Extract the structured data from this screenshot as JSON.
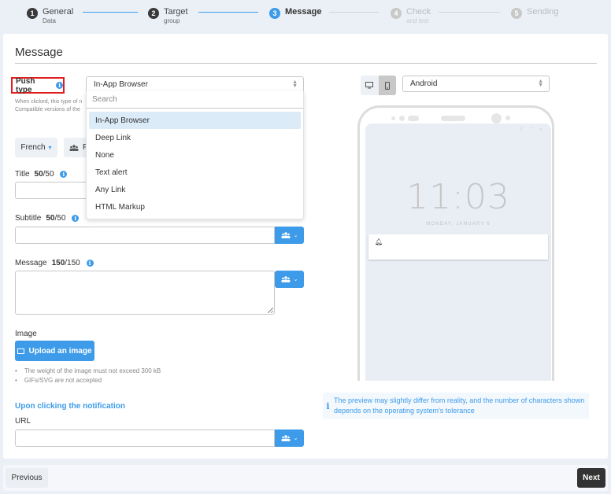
{
  "stepper": {
    "steps": [
      {
        "num": "1",
        "title": "General",
        "sub": "Data",
        "state": "done"
      },
      {
        "num": "2",
        "title": "Target",
        "sub": "group",
        "state": "done"
      },
      {
        "num": "3",
        "title": "Message",
        "sub": "",
        "state": "active"
      },
      {
        "num": "4",
        "title": "Check",
        "sub": "and test",
        "state": "todo"
      },
      {
        "num": "5",
        "title": "Sending",
        "sub": "",
        "state": "todo"
      }
    ]
  },
  "card": {
    "title": "Message"
  },
  "push_type": {
    "label": "Push type",
    "info_icon": "i",
    "help_line1": "When clicked, this type of n",
    "help_line2": "Compatible versions of the",
    "selected": "In-App Browser",
    "dropdown": {
      "search_placeholder": "Search",
      "options": [
        "In-App Browser",
        "Deep Link",
        "None",
        "Text alert",
        "Any Link",
        "HTML Markup"
      ]
    }
  },
  "language_button": {
    "label": "French",
    "chevron": "⌄"
  },
  "persona_button": {
    "label": "P"
  },
  "fields": {
    "title": {
      "label": "Title",
      "count": "50",
      "max": "/50",
      "value": ""
    },
    "subtitle": {
      "label": "Subtitle",
      "count": "50",
      "max": "/50",
      "value": ""
    },
    "message": {
      "label": "Message",
      "count": "150",
      "max": "/150",
      "value": ""
    },
    "url": {
      "label": "URL",
      "value": ""
    }
  },
  "image": {
    "label": "Image",
    "upload_label": "Upload an image",
    "rules": [
      "The weight of the image must not exceed 300 kB",
      "GIFs/SVG are not accepted"
    ]
  },
  "click_section": {
    "heading": "Upon clicking the notification"
  },
  "preview": {
    "device_toggle": [
      "desktop",
      "mobile"
    ],
    "active_device": "mobile",
    "os_select": "Android",
    "clock": "11:03",
    "date": "MONDAY, JANUARY 6",
    "note": "The preview may slightly differ from reality, and the number of characters shown depends on the operating system's tolerance"
  },
  "footer": {
    "previous_label": "Previous",
    "next_label": "Next"
  },
  "colors": {
    "accent": "#3d9be9",
    "highlight_border": "#e01e1e",
    "dark_button": "#333333"
  }
}
